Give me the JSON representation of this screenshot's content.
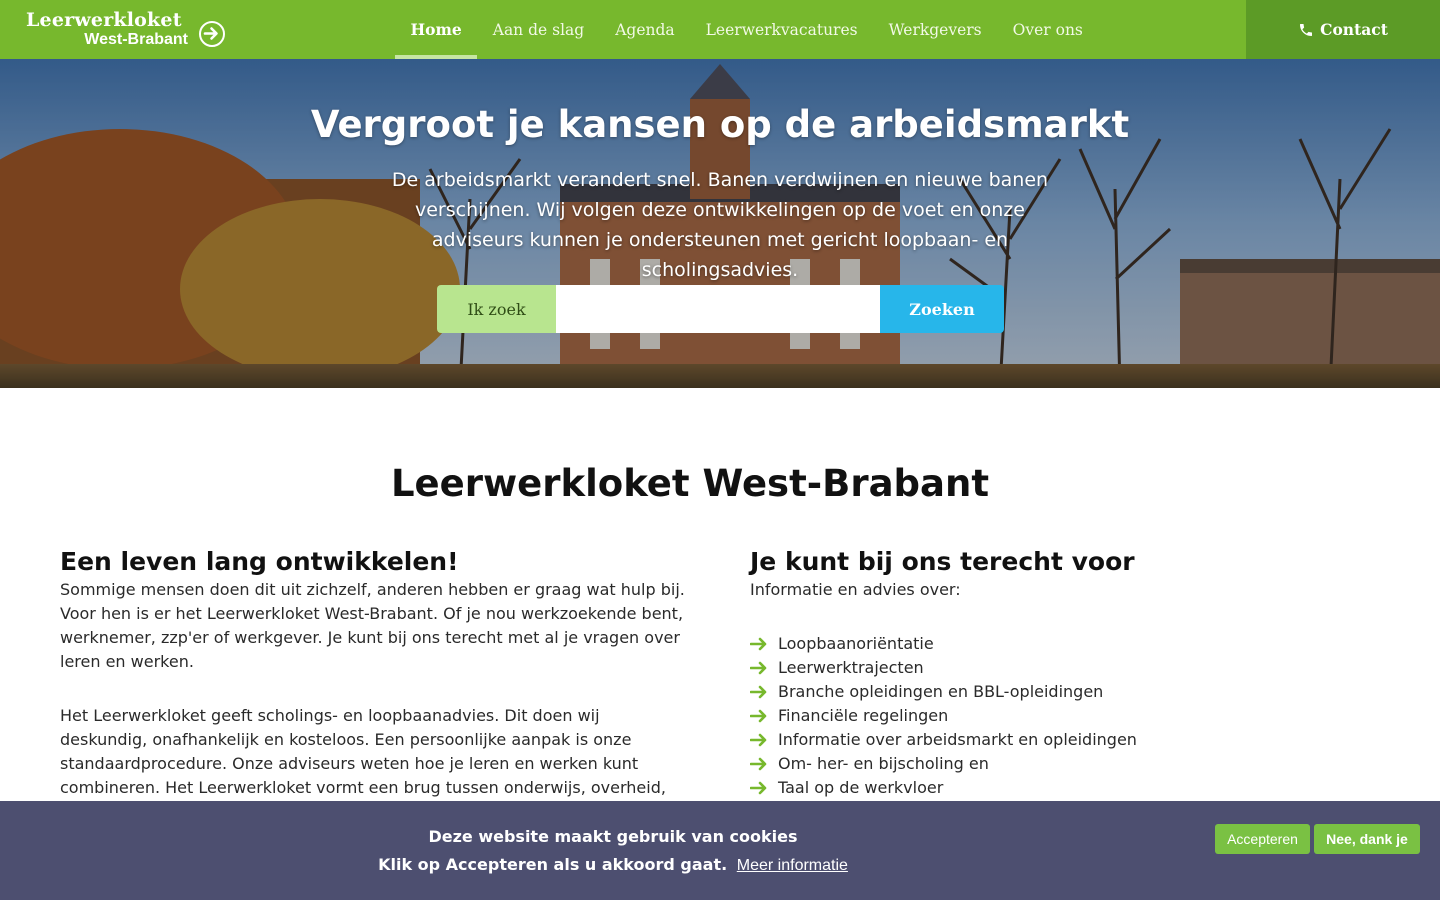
{
  "header": {
    "logo": {
      "line1": "Leerwerkloket",
      "line2": "West-Brabant",
      "icon": "arrow-circle-right-icon"
    },
    "nav": [
      {
        "label": "Home",
        "active": true
      },
      {
        "label": "Aan de slag",
        "active": false
      },
      {
        "label": "Agenda",
        "active": false
      },
      {
        "label": "Leerwerkvacatures",
        "active": false
      },
      {
        "label": "Werkgevers",
        "active": false
      },
      {
        "label": "Over ons",
        "active": false
      }
    ],
    "contact": {
      "label": "Contact",
      "icon": "phone-icon"
    }
  },
  "hero": {
    "title": "Vergroot je kansen op de arbeidsmarkt",
    "text": "De arbeidsmarkt verandert snel. Banen verdwijnen en nieuwe banen verschijnen. Wij volgen deze ontwikkelingen op de voet en onze adviseurs kunnen je ondersteunen met gericht loopbaan- en scholingsadvies.",
    "search": {
      "label": "Ik zoek",
      "value": "",
      "placeholder": "",
      "button": "Zoeken"
    }
  },
  "main": {
    "title": "Leerwerkloket West-Brabant",
    "left": {
      "heading": "Een leven lang ontwikkelen!",
      "paragraphs": [
        "Sommige mensen doen dit uit zichzelf, anderen hebben er graag wat hulp bij. Voor hen is er het Leerwerkloket West-Brabant. Of je nou werkzoekende bent, werknemer, zzp'er of werkgever. Je kunt bij ons terecht met al je vragen over leren en werken.",
        "Het Leerwerkloket geeft scholings- en loopbaanadvies. Dit doen wij deskundig, onafhankelijk en kosteloos.  Een persoonlijke aanpak is onze standaardprocedure. Onze adviseurs weten hoe je leren en werken kunt combineren. Het Leerwerkloket vormt een brug tussen onderwijs, overheid, werkgever en werknemer."
      ]
    },
    "right": {
      "heading": "Je kunt bij ons terecht voor",
      "intro": "Informatie en advies over:",
      "items": [
        "Loopbaanoriëntatie",
        "Leerwerktrajecten",
        "Branche opleidingen en BBL-opleidingen",
        "Financiële regelingen",
        "Informatie over arbeidsmarkt en opleidingen",
        "Om- her- en bijscholing en",
        "Taal op de werkvloer"
      ],
      "item_icon": "arrow-right-icon"
    }
  },
  "cookie": {
    "title": "Deze website maakt gebruik van cookies",
    "text": "Klik op Accepteren als u akkoord gaat.",
    "link": "Meer informatie",
    "accept": "Accepteren",
    "decline": "Nee, dank je"
  },
  "colors": {
    "brand_green": "#77b82d",
    "contact_green": "#5c9b26",
    "search_label_bg": "#b8e58f",
    "search_button": "#27b6ea",
    "cookie_bg": "#4d4f70",
    "cookie_button": "#7ac143"
  }
}
